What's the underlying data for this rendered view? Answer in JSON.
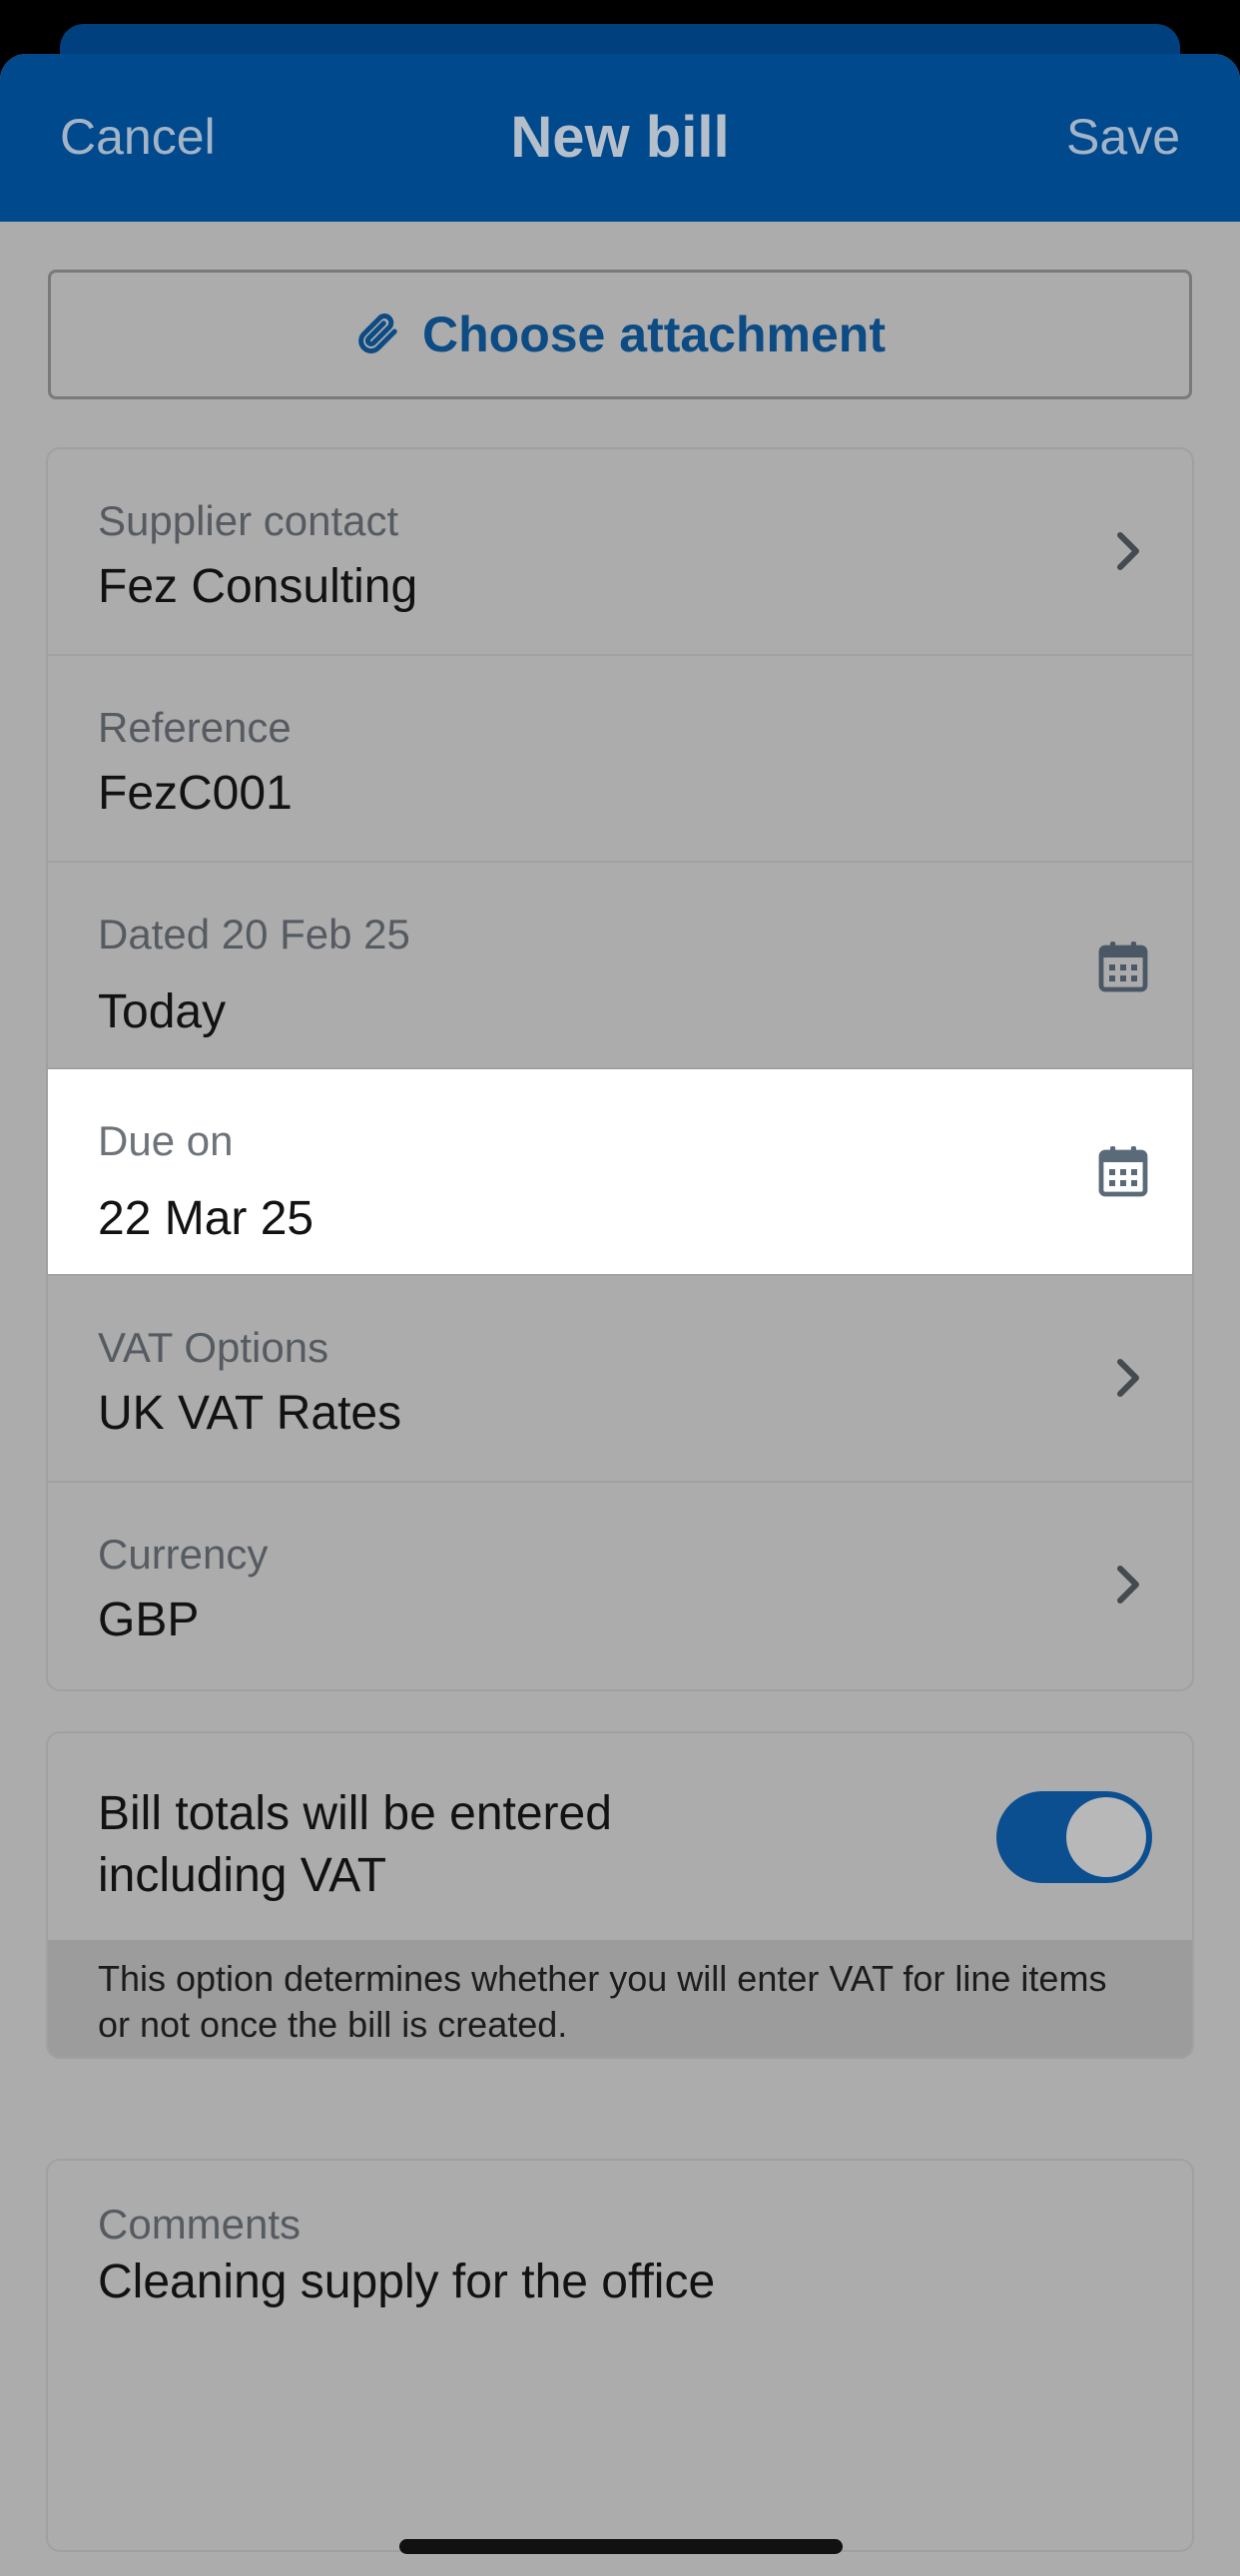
{
  "nav": {
    "cancel_label": "Cancel",
    "title": "New bill",
    "save_label": "Save"
  },
  "attachment": {
    "label": "Choose attachment",
    "icon": "paperclip-icon"
  },
  "details": [
    {
      "label": "Supplier contact",
      "value": "Fez Consulting",
      "icon": "chevron-right-icon"
    },
    {
      "label": "Reference",
      "value": "FezC001",
      "icon": ""
    },
    {
      "label": "Dated 20 Feb 25",
      "value": "Today",
      "icon": "calendar-icon"
    },
    {
      "label": "Due on",
      "value": "22 Mar 25",
      "icon": "calendar-icon"
    },
    {
      "label": "VAT Options",
      "value": "UK VAT Rates",
      "icon": "chevron-right-icon"
    },
    {
      "label": "Currency",
      "value": "GBP",
      "icon": "chevron-right-icon"
    }
  ],
  "vat": {
    "label": "Bill totals will be entered including VAT",
    "toggle_on": true,
    "note": "This option determines whether you will enter VAT for line items or not once the bill is created."
  },
  "comments": {
    "label": "Comments",
    "value": "Cleaning supply for the office"
  },
  "colors": {
    "brand": "#00498d",
    "overlay": "#acacac",
    "toggle": "#0c4f91"
  }
}
